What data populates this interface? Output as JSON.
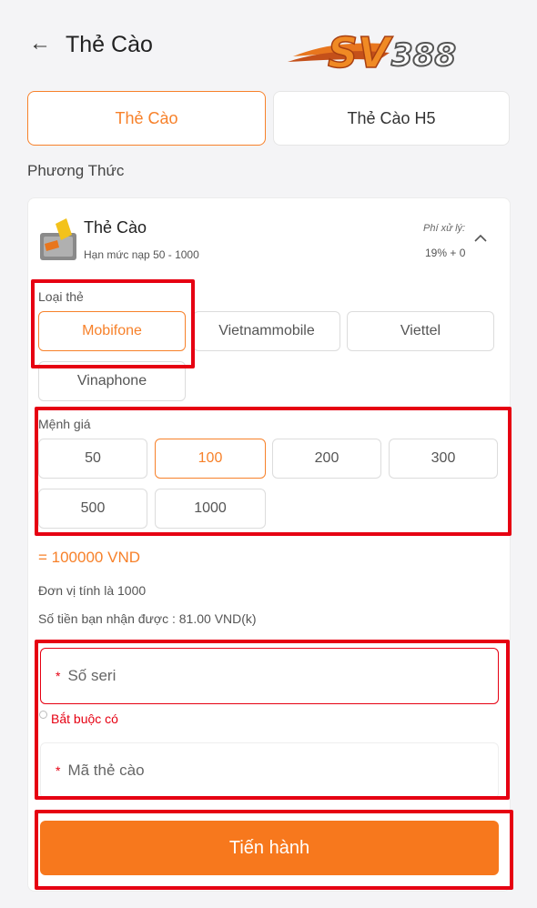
{
  "header": {
    "back_icon": "arrow-left-icon",
    "title": "Thẻ Cào",
    "logo_text": "SV388"
  },
  "tabs": [
    {
      "label": "Thẻ Cào",
      "active": true
    },
    {
      "label": "Thẻ Cào H5",
      "active": false
    }
  ],
  "section_label": "Phương Thức",
  "method": {
    "icon": "card-icon",
    "title": "Thẻ Cào",
    "limit": "Hạn mức nạp 50 - 1000",
    "fee_label": "Phí xử lý:",
    "fee_value": "19% + 0",
    "toggle_icon": "chevron-up-icon"
  },
  "card_type": {
    "label": "Loại thẻ",
    "options": [
      "Mobifone",
      "Vietnammobile",
      "Viettel",
      "Vinaphone"
    ],
    "selected": "Mobifone"
  },
  "denomination": {
    "label": "Mệnh giá",
    "options": [
      "50",
      "100",
      "200",
      "300",
      "500",
      "1000"
    ],
    "selected": "100"
  },
  "total": "= 100000 VND",
  "unit_note": "Đơn vị tính là 1000",
  "receive_note": "Số tiền bạn nhận được : 81.00 VND(k)",
  "serial_field": {
    "required_mark": "*",
    "placeholder": "Số seri",
    "error": "Bắt buộc có"
  },
  "code_field": {
    "required_mark": "*",
    "placeholder": "Mã thẻ cào"
  },
  "submit_label": "Tiến hành",
  "colors": {
    "accent": "#f7812a",
    "button": "#f7781d",
    "highlight": "#e60012",
    "error": "#e60012"
  }
}
